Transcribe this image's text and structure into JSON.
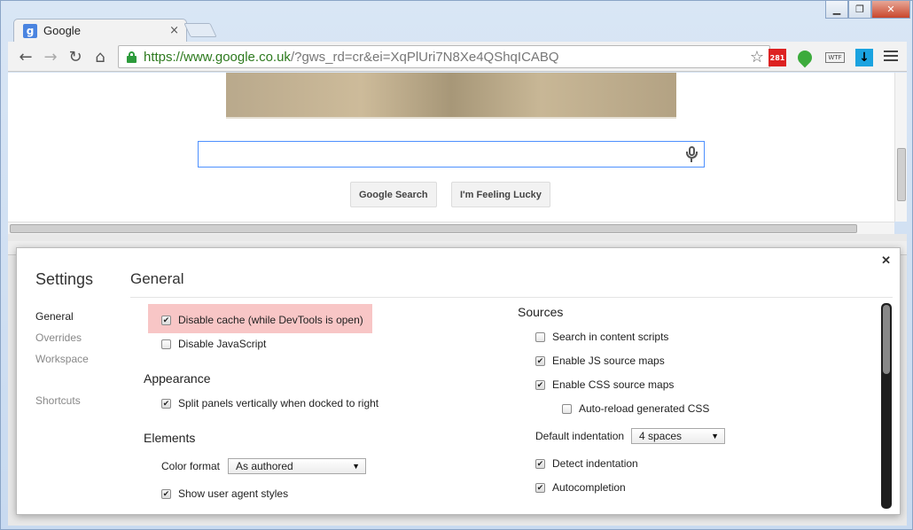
{
  "browser": {
    "tab_title": "Google",
    "tab_favicon": "g",
    "url_scheme_host": "https://www.google.co.uk",
    "url_rest": "/?gws_rd=cr&ei=XqPlUri7N8Xe4QShqICABQ",
    "extensions": {
      "gmail_count": "281",
      "wtf_label": "WTF"
    }
  },
  "page": {
    "search_button": "Google Search",
    "lucky_button": "I'm Feeling Lucky"
  },
  "settings": {
    "title": "Settings",
    "nav": [
      "General",
      "Overrides",
      "Workspace",
      "Shortcuts"
    ],
    "section_title": "General",
    "general": {
      "disable_cache": "Disable cache (while DevTools is open)",
      "disable_js": "Disable JavaScript"
    },
    "appearance": {
      "title": "Appearance",
      "split_panels": "Split panels vertically when docked to right"
    },
    "elements": {
      "title": "Elements",
      "color_format_label": "Color format",
      "color_format_value": "As authored",
      "show_ua_styles": "Show user agent styles"
    },
    "sources": {
      "title": "Sources",
      "search_content_scripts": "Search in content scripts",
      "enable_js_maps": "Enable JS source maps",
      "enable_css_maps": "Enable CSS source maps",
      "auto_reload_css": "Auto-reload generated CSS",
      "default_indent_label": "Default indentation",
      "default_indent_value": "4 spaces",
      "detect_indent": "Detect indentation",
      "autocompletion": "Autocompletion"
    }
  },
  "colors": {
    "highlight": "#f8c6c6",
    "url_host": "#2d7a1e",
    "accent": "#4d90fe"
  }
}
